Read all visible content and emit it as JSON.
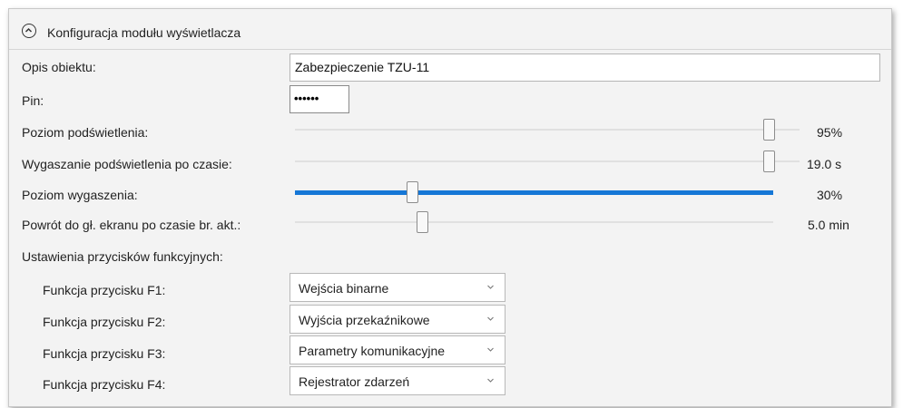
{
  "section": {
    "title": "Konfiguracja modułu wyświetlacza"
  },
  "fields": {
    "description_label": "Opis obiektu:",
    "description_value": "Zabezpieczenie TZU-11",
    "pin_label": "Pin:",
    "pin_value": "••••••"
  },
  "sliders": [
    {
      "label": "Poziom podświetlenia:",
      "value_text": "95%",
      "level": 0.95
    },
    {
      "label": "Wygaszanie podświetlenia po czasie:",
      "value_text": "19.0 s",
      "level": 0.95
    },
    {
      "label": "Poziom wygaszenia:",
      "value_text": "30%",
      "level": 0.24
    },
    {
      "label": "Powrót do gł. ekranu po czasie br. akt.:",
      "value_text": "5.0 min",
      "level": 0.26
    }
  ],
  "function_keys": {
    "heading": "Ustawienia przycisków funkcyjnych:",
    "items": [
      {
        "label": "Funkcja przycisku F1:",
        "selected": "Wejścia binarne"
      },
      {
        "label": "Funkcja przycisku F2:",
        "selected": "Wyjścia przekaźnikowe"
      },
      {
        "label": "Funkcja przycisku F3:",
        "selected": "Parametry komunikacyjne"
      },
      {
        "label": "Funkcja przycisku F4:",
        "selected": "Rejestrator zdarzeń"
      }
    ]
  },
  "colors": {
    "accent": "#1577d6",
    "panel_bg": "#f3f3f3"
  }
}
